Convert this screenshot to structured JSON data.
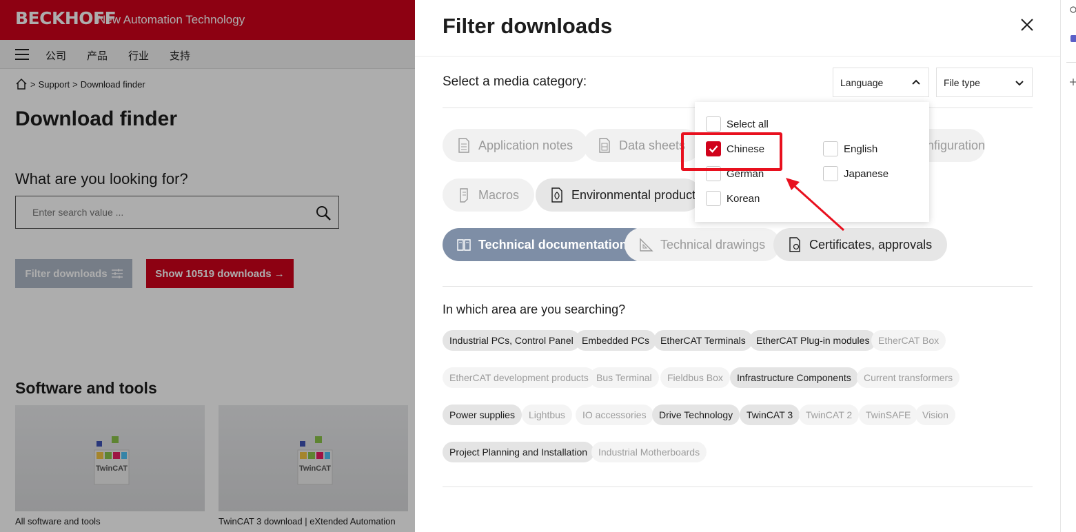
{
  "site": {
    "logo": "BECKHOFF",
    "tagline": "New Automation Technology",
    "nav": [
      "公司",
      "产品",
      "行业",
      "支持"
    ]
  },
  "breadcrumb": {
    "items": [
      "Support",
      "Download finder"
    ],
    "separator": ">"
  },
  "page": {
    "title": "Download finder",
    "search_heading": "What are you looking for?",
    "search_placeholder": "Enter search value ...",
    "filter_button": "Filter downloads",
    "show_button": "Show 10519 downloads →",
    "software_heading": "Software and tools",
    "cards": [
      {
        "caption": "All software and tools"
      },
      {
        "caption": "TwinCAT 3 download | eXtended Automation"
      }
    ],
    "cube_label": "TwinCAT"
  },
  "drawer": {
    "title": "Filter downloads",
    "media_label": "Select a media category:",
    "language_dropdown": "Language",
    "filetype_dropdown": "File type",
    "categories": [
      {
        "label": "Application notes",
        "state": "muted",
        "icon": "document-icon"
      },
      {
        "label": "Data sheets",
        "state": "muted",
        "icon": "datasheet-icon"
      },
      {
        "label": "Configuration files",
        "state": "muted",
        "icon": "config-icon"
      },
      {
        "label": "Macros",
        "state": "muted",
        "icon": "macro-icon"
      },
      {
        "label": "Environmental product compliance",
        "state": "active",
        "icon": "leaf-icon"
      },
      {
        "label": "Technical documentations",
        "state": "selected",
        "icon": "book-icon"
      },
      {
        "label": "Technical drawings",
        "state": "muted",
        "icon": "ruler-icon"
      },
      {
        "label": "Certificates, approvals",
        "state": "active",
        "icon": "certificate-icon"
      }
    ],
    "area_label": "In which area are you searching?",
    "areas": [
      {
        "label": "Industrial PCs, Control Panel",
        "on": true
      },
      {
        "label": "Embedded PCs",
        "on": true
      },
      {
        "label": "EtherCAT Terminals",
        "on": true
      },
      {
        "label": "EtherCAT Plug-in modules",
        "on": true
      },
      {
        "label": "EtherCAT Box",
        "on": false
      },
      {
        "label": "EtherCAT development products",
        "on": false
      },
      {
        "label": "Bus Terminal",
        "on": false
      },
      {
        "label": "Fieldbus Box",
        "on": false
      },
      {
        "label": "Infrastructure Components",
        "on": true
      },
      {
        "label": "Current transformers",
        "on": false
      },
      {
        "label": "Power supplies",
        "on": true
      },
      {
        "label": "Lightbus",
        "on": false
      },
      {
        "label": "IO accessories",
        "on": false
      },
      {
        "label": "Drive Technology",
        "on": true
      },
      {
        "label": "TwinCAT 3",
        "on": true
      },
      {
        "label": "TwinCAT 2",
        "on": false
      },
      {
        "label": "TwinSAFE",
        "on": false
      },
      {
        "label": "Vision",
        "on": false
      },
      {
        "label": "Project Planning and Installation",
        "on": true
      },
      {
        "label": "Industrial Motherboards",
        "on": false
      }
    ]
  },
  "language_panel": {
    "select_all": "Select all",
    "options": [
      {
        "label": "Chinese",
        "checked": true
      },
      {
        "label": "English",
        "checked": false
      },
      {
        "label": "German",
        "checked": false
      },
      {
        "label": "Japanese",
        "checked": false
      },
      {
        "label": "Korean",
        "checked": false
      }
    ]
  },
  "colors": {
    "brand_red": "#d0021b",
    "selected_pill": "#7e8ea6",
    "annotation_red": "#e8101e"
  }
}
